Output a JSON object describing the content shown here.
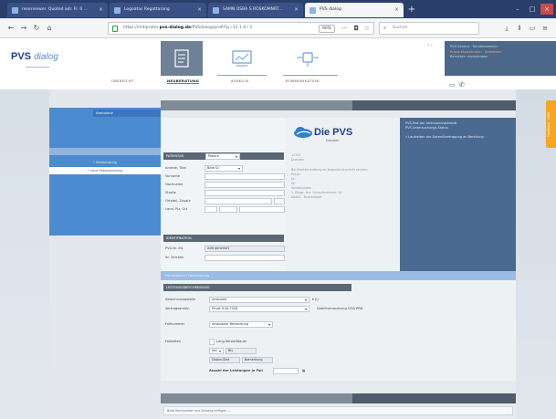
{
  "browser": {
    "tabs": [
      {
        "label": "reserviewer. Quoted adr. Fr. 0 ...",
        "active": false
      },
      {
        "label": "Logoatas Regattarang",
        "active": false
      },
      {
        "label": "SAMN OSBA S ROSKOMNRT...",
        "active": false
      },
      {
        "label": "PVS dialog",
        "active": true
      }
    ],
    "url_prefix": "https://mitiprater.",
    "url_domain": "pvs-dialog.de",
    "url_suffix": "/PVSdialog/profil?p=12 1 0 / 1",
    "zoom": "90%",
    "search_placeholder": "Suchen"
  },
  "site": {
    "logo_main": "PVS",
    "logo_sub": "dialog",
    "nav": [
      {
        "label": "ÜBERSICHT",
        "active": false
      },
      {
        "label": "NEUBERATUNG",
        "active": true
      },
      {
        "label": "AUSKU.N",
        "active": false
      },
      {
        "label": "KOMMUNIKATION",
        "active": false
      }
    ],
    "user_line1": "PVS-Service · Kundenbereich",
    "user_line2": "Praxis Mustermann · Abmelden",
    "user_line3": "Benutzer: mustermann",
    "header_controls": "X |"
  },
  "sidebar": {
    "top_item": "Ambulanz",
    "items": [
      "• Neuberatung",
      "• neue Fallanmeldung"
    ]
  },
  "form": {
    "sec_patient": "PATIENT/IN",
    "patient_type": "Patient",
    "rows": [
      {
        "label": "Anrede, Titel",
        "value": "Bitte Di"
      },
      {
        "label": "Vorname",
        "value": ""
      },
      {
        "label": "Nachname",
        "value": ""
      },
      {
        "label": "Straße",
        "value": ""
      },
      {
        "label": "Ortsteil, Zusatz",
        "value": ""
      },
      {
        "label": "Land, Plz, Ort",
        "value": ""
      }
    ],
    "sec_id": "IDENTIFIKATION",
    "id_rows": [
      {
        "label": "PVS-Nr. lfd.",
        "value": "wird generiert"
      },
      {
        "label": "Ihr Zeichen",
        "value": ""
      }
    ]
  },
  "info": {
    "brand": "Die PVS",
    "brand_sub": "Dresden",
    "lines": [
      "12345",
      "Dresden",
      "",
      "Bei Direkterstattung an folgende Anschrift senden:",
      "Praxis",
      "Dr.",
      "Str.",
      "Kontaktdaten",
      "1. Etage, Hst. Schaufensterstr. 50",
      "00000 · Musterstadt"
    ]
  },
  "right": {
    "lines": [
      "PVS-Test der Ambulanz/stationär",
      "PVS-Untersuchungs-Status",
      "",
      "» Laufzeiten der Datenübertragung an Bereitung"
    ]
  },
  "lower": {
    "bar_label": "Fall erfassen / Neuberatung",
    "sec": "LEISTUNGSBESCHREIBUNG",
    "rows": [
      {
        "label": "Abrechnungsstelle",
        "value": "Ambulant"
      },
      {
        "label": "Vertragsarzt/in",
        "value": "Privat GOA-7328"
      }
    ],
    "side_note": "Gebührenordnung GOÄ PRD",
    "row3_label": "Fallnummer",
    "row3_value": "Ambulante Behandlung",
    "row4_label": "Fallzeiten",
    "check_label": "Lang-Verweildauer",
    "cols": [
      "Von",
      "Bis"
    ],
    "col_hdrs": [
      "Datum/Zeit",
      "Bemerkung"
    ],
    "count_label": "Anzahl der Leistungen je Fall",
    "footer": "Bitte Kommentar und Anhang anfügen ..."
  },
  "feedback": "Feedback · Hilfe"
}
